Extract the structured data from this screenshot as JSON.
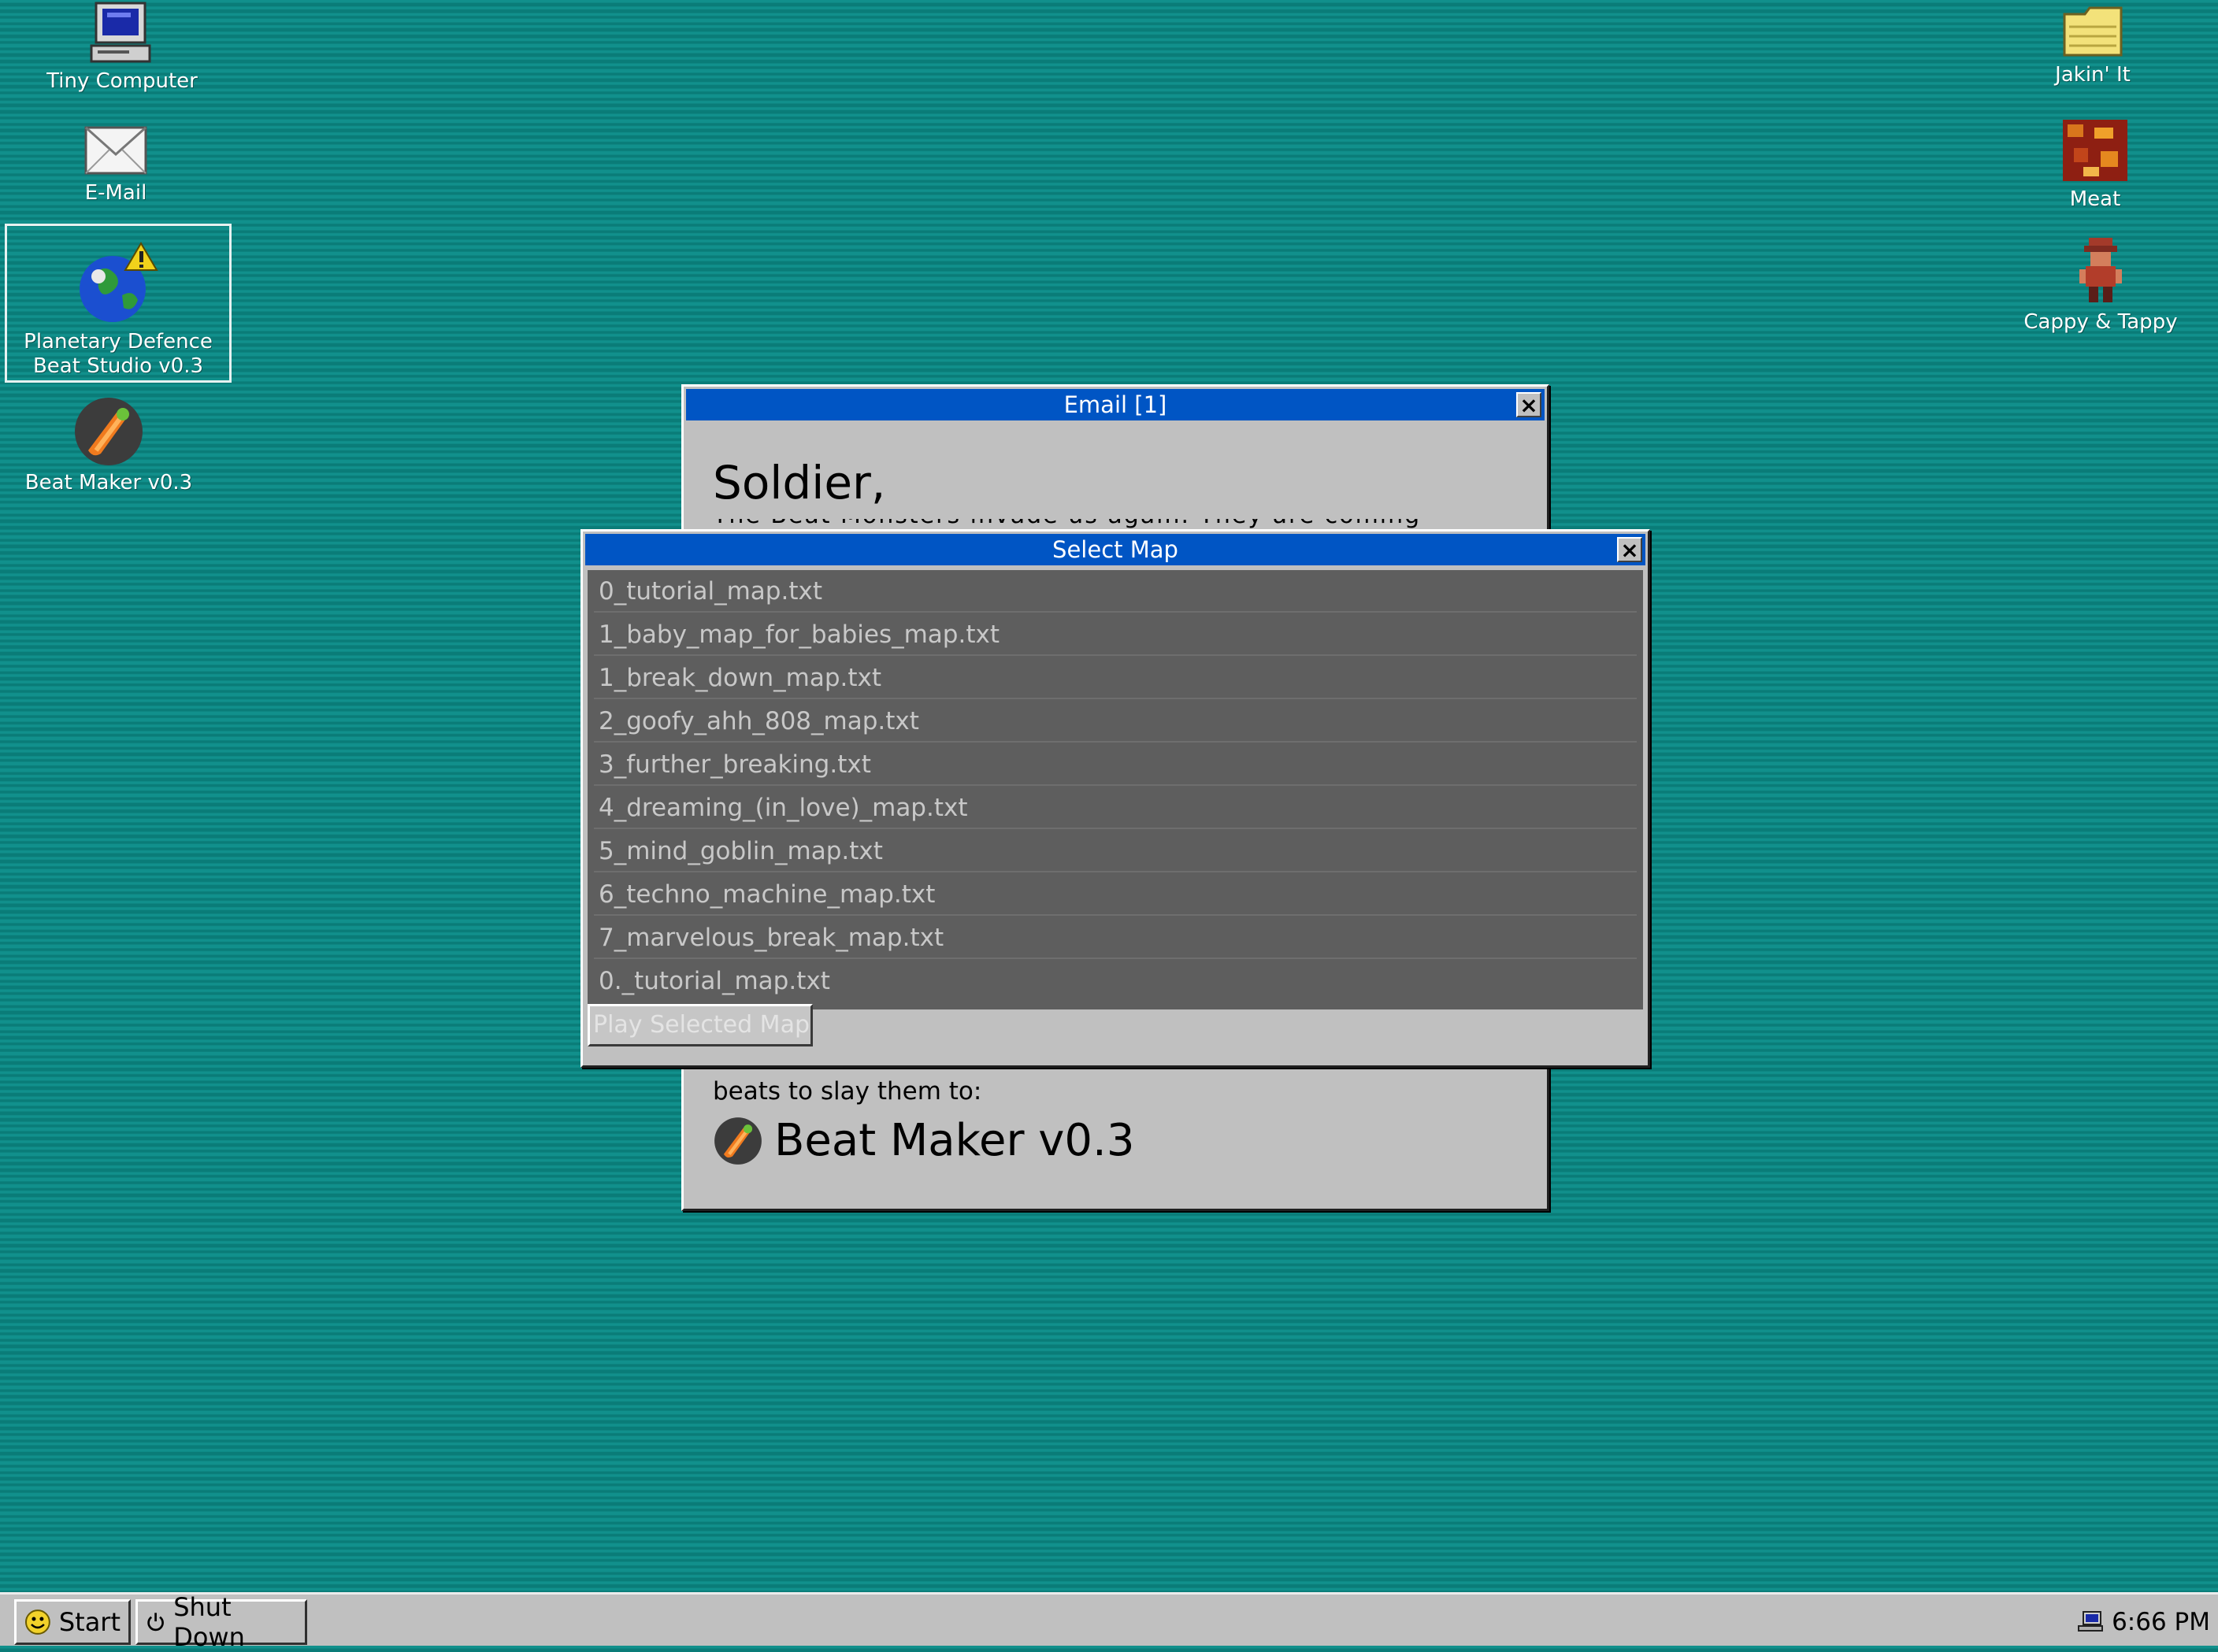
{
  "desktop_left": [
    {
      "label": "Tiny Computer",
      "icon": "computer-icon"
    },
    {
      "label": "E-Mail",
      "icon": "envelope-icon"
    },
    {
      "label": "Planetary Defence\nBeat Studio v0.3",
      "icon": "globe-warning-icon"
    },
    {
      "label": "Beat Maker v0.3",
      "icon": "beat-maker-icon"
    }
  ],
  "desktop_right": [
    {
      "label": "Jakin' It",
      "icon": "folder-icon"
    },
    {
      "label": "Meat",
      "icon": "meat-icon"
    },
    {
      "label": "Cappy & Tappy",
      "icon": "character-icon"
    }
  ],
  "email_window": {
    "title": "Email [1]",
    "close": "×",
    "heading": "Soldier,",
    "partial_line": "The Beat Monsters invade us again. They are coming back to destroy",
    "body_line": "beats to slay them to:",
    "app_name": "Beat Maker v0.3"
  },
  "map_window": {
    "title": "Select Map",
    "close": "×",
    "maps": [
      "0_tutorial_map.txt",
      "1_baby_map_for_babies_map.txt",
      "1_break_down_map.txt",
      "2_goofy_ahh_808_map.txt",
      "3_further_breaking.txt",
      "4_dreaming_(in_love)_map.txt",
      "5_mind_goblin_map.txt",
      "6_techno_machine_map.txt",
      "7_marvelous_break_map.txt",
      "0._tutorial_map.txt"
    ],
    "play_button": "Play Selected Map"
  },
  "taskbar": {
    "start_label": "Start",
    "shutdown_label": "Shut Down",
    "clock": "6:66 PM"
  },
  "colors": {
    "desktop": "#0f8a86",
    "titlebar": "#0055c4",
    "window": "#c0c0c0",
    "list_bg": "#5e5e5e",
    "list_text": "#c8c8c8"
  }
}
